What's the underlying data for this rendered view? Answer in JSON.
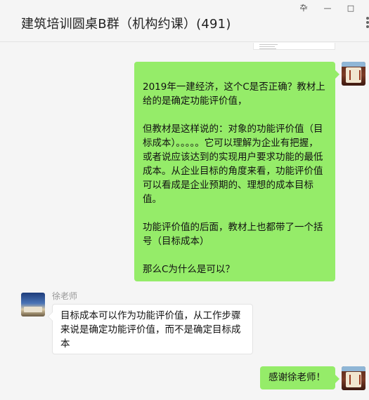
{
  "window": {
    "title": "建筑培训圆桌B群（机构约课）(491)",
    "controls": {
      "pin": "卆",
      "minimize": "—",
      "maximize": "□"
    }
  },
  "icons": {
    "pin": "pin-icon",
    "minimize": "minimize-icon",
    "maximize": "maximize-icon",
    "more": "more-icon",
    "self_avatar": "self-avatar",
    "teacher_avatar": "teacher-avatar"
  },
  "colors": {
    "outgoing_bubble": "#95ec69",
    "incoming_bubble": "#ffffff",
    "background": "#f5f5f5"
  },
  "messages": [
    {
      "from": "self",
      "paragraphs": [
        "2019年一建经济，这个C是否正确？教材上给的是确定功能评价值，",
        "但教材是这样说的：对象的功能评价值（目标成本）。。。。。它可以理解为企业有把握，或者说应该达到的实现用户要求功能的最低成本。从企业目标的角度来看，功能评价值可以看成是企业预期的、理想的成本目标值。",
        "功能评价值的后面，教材上也都带了一个括号（目标成本）",
        "那么C为什么是可以？"
      ]
    },
    {
      "from": "other",
      "sender": "徐老师",
      "text": "目标成本可以作为功能评价值，从工作步骤来说是确定功能评价值，而不是确定目标成本"
    },
    {
      "from": "self",
      "text": "感谢徐老师！"
    }
  ]
}
